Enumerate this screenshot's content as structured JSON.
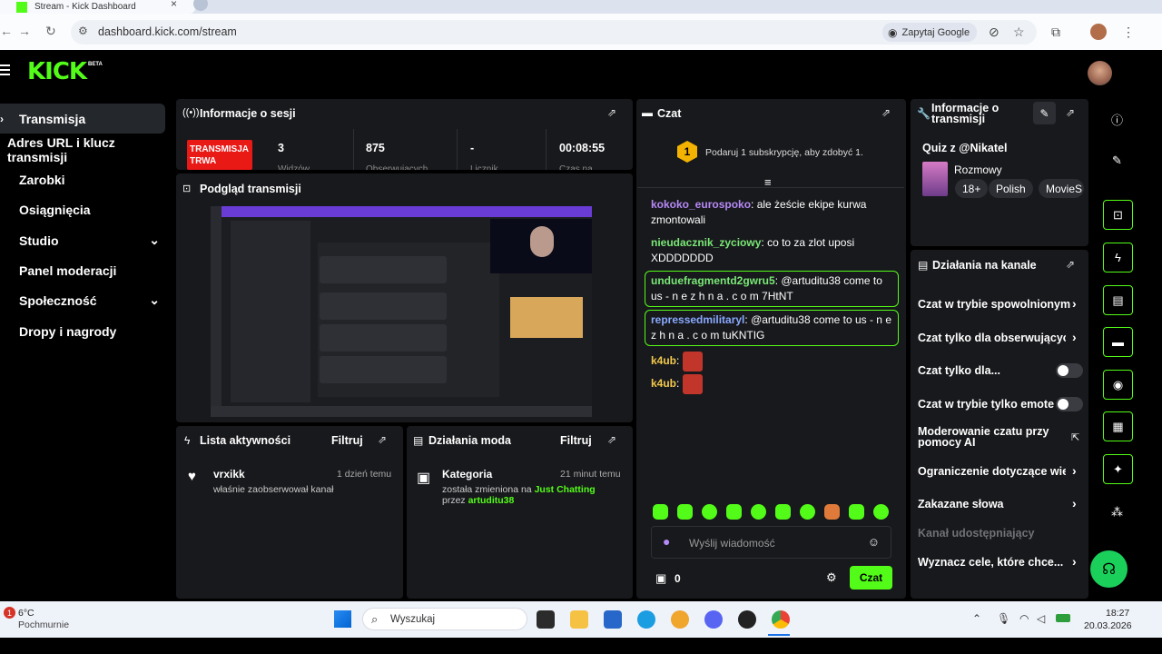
{
  "browser": {
    "tab_title": "Stream - Kick Dashboard",
    "url": "dashboard.kick.com/stream",
    "ask_google": "Zapytaj Google"
  },
  "header": {
    "logo": "KICK",
    "beta": "BETA"
  },
  "sidenav": {
    "items": [
      {
        "label": "Transmisja"
      },
      {
        "label": "Adres URL i klucz transmisji"
      },
      {
        "label": "Zarobki"
      },
      {
        "label": "Osiągnięcia"
      },
      {
        "label": "Studio"
      },
      {
        "label": "Panel moderacji"
      },
      {
        "label": "Społeczność"
      },
      {
        "label": "Dropy i nagrody"
      }
    ]
  },
  "session": {
    "title": "Informacje o sesji",
    "badge_line1": "TRANSMISJA",
    "badge_line2": "TRWA",
    "stats": [
      {
        "value": "3",
        "label": "Widzów"
      },
      {
        "value": "875",
        "label": "Obserwujących"
      },
      {
        "value": "-",
        "label": "Licznik"
      },
      {
        "value": "00:08:55",
        "label": "Czas na"
      }
    ]
  },
  "preview": {
    "title": "Podgląd transmisji"
  },
  "activity": {
    "title": "Lista aktywności",
    "filter": "Filtruj",
    "items": [
      {
        "user": "vrxikk",
        "time": "1 dzień temu",
        "text": "właśnie zaobserwował kanał"
      }
    ]
  },
  "mod_actions": {
    "title": "Działania moda",
    "filter": "Filtruj",
    "items": [
      {
        "title": "Kategoria",
        "time": "21 minut temu",
        "text_pre": "została zmieniona na ",
        "category": "Just Chatting",
        "by_pre": "przez ",
        "by_user": "artuditu38"
      }
    ]
  },
  "chat": {
    "title": "Czat",
    "sub_badge": "1",
    "sub_prompt": "Podaruj 1 subskrypcję, aby zdobyć 1.",
    "messages": [
      {
        "user": "kokoko_eurospoko",
        "text": "ale żeście ekipe kurwa zmontowali"
      },
      {
        "user": "nieudacznik_zyciowy",
        "text": "co to za zlot uposi XDDDDDDD"
      },
      {
        "user": "unduefragmentd2gwru5",
        "text": "@artuditu38 come to us - n e z h n a . c o m 7HtNT"
      },
      {
        "user": "repressedmilitaryl",
        "text": "@artuditu38 come to us - n e z h n a . c o m tuKNTIG"
      },
      {
        "user": "k4ub",
        "text": ""
      },
      {
        "user": "k4ub",
        "text": ""
      }
    ],
    "input_placeholder": "Wyślij wiadomość",
    "points": "0",
    "send_label": "Czat"
  },
  "stream_info": {
    "title": "Informacje o transmisji",
    "stream_title": "Quiz z @Nikatel",
    "category": "Rozmowy",
    "tags": [
      "18+",
      "Polish",
      "MovieS"
    ]
  },
  "channel_actions": {
    "title": "Działania na kanale",
    "items": [
      {
        "label": "Czat w trybie spowolnionym"
      },
      {
        "label": "Czat tylko dla obserwujących"
      },
      {
        "label": "Czat tylko dla..."
      },
      {
        "label": "Czat w trybie tylko emotek"
      },
      {
        "label": "Moderowanie czatu przy pomocy AI"
      },
      {
        "label": "Ograniczenie dotyczące wiek"
      },
      {
        "label": "Zakazane słowa"
      },
      {
        "label": "Kanał udostępniający"
      },
      {
        "label": "Wyznacz cele, które chce..."
      }
    ]
  },
  "taskbar": {
    "weather_temp": "6°C",
    "weather_desc": "Pochmurnie",
    "weather_badge": "1",
    "search": "Wyszukaj",
    "time": "18:27",
    "date": "20.03.2026"
  },
  "colors": {
    "accent": "#53fc18",
    "live": "#e91916",
    "panel": "#18191c"
  }
}
